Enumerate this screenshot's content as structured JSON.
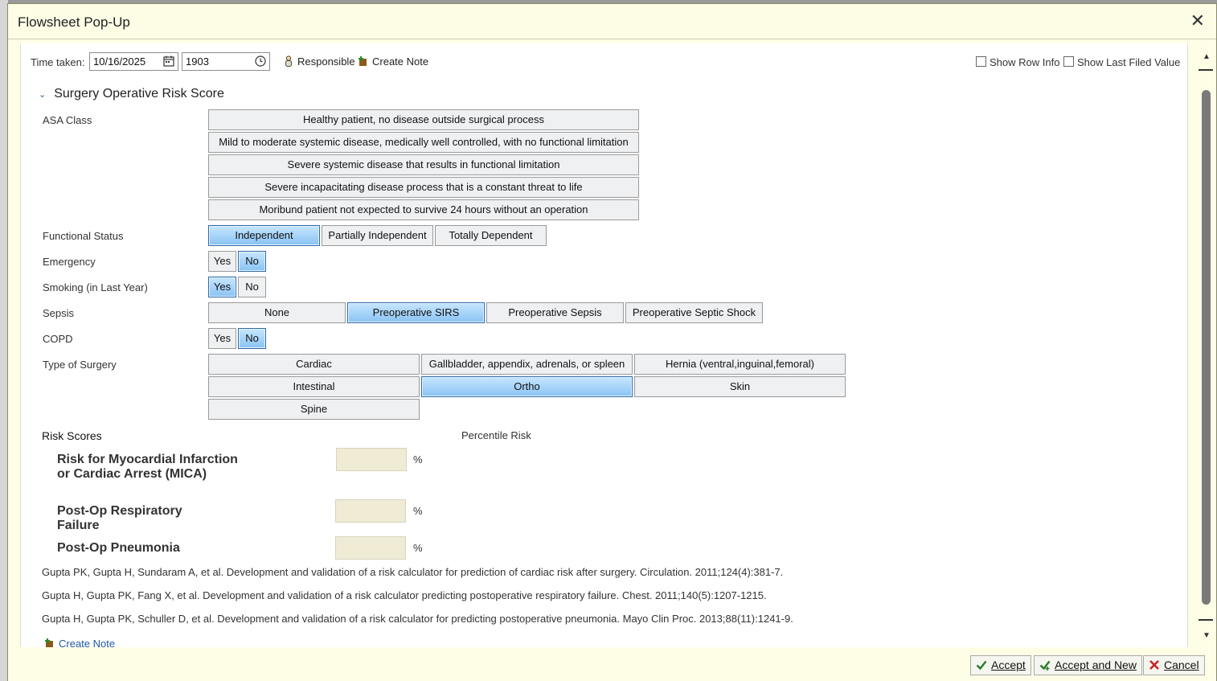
{
  "dialog": {
    "title": "Flowsheet Pop-Up",
    "close_symbol": "✕"
  },
  "toolbar": {
    "time_taken_label": "Time taken:",
    "date_value": "10/16/2025",
    "time_value": "1903",
    "responsible_label": "Responsible",
    "create_note_label": "Create Note",
    "show_row_info_label": "Show Row Info",
    "show_last_filed_label": "Show Last Filed Value"
  },
  "section": {
    "title": "Surgery Operative Risk Score"
  },
  "asa": {
    "label": "ASA Class",
    "options": [
      "Healthy patient, no disease outside surgical process",
      "Mild to moderate systemic disease, medically well controlled, with no functional limitation",
      "Severe systemic disease that results in functional limitation",
      "Severe incapacitating disease process that is a constant threat to life",
      "Moribund patient not expected to survive 24 hours without an operation"
    ]
  },
  "functional_status": {
    "label": "Functional Status",
    "options": [
      "Independent",
      "Partially Independent",
      "Totally Dependent"
    ],
    "selected": "Independent"
  },
  "emergency": {
    "label": "Emergency",
    "options": [
      "Yes",
      "No"
    ],
    "selected": "No"
  },
  "smoking": {
    "label": "Smoking (in Last Year)",
    "options": [
      "Yes",
      "No"
    ],
    "selected": "Yes"
  },
  "sepsis": {
    "label": "Sepsis",
    "options": [
      "None",
      "Preoperative SIRS",
      "Preoperative Sepsis",
      "Preoperative Septic Shock"
    ],
    "selected": "Preoperative SIRS"
  },
  "copd": {
    "label": "COPD",
    "options": [
      "Yes",
      "No"
    ],
    "selected": "No"
  },
  "surgery_type": {
    "label": "Type of Surgery",
    "options": [
      "Cardiac",
      "Gallbladder, appendix, adrenals, or spleen",
      "Hernia (ventral,inguinal,femoral)",
      "Intestinal",
      "Ortho",
      "Skin",
      "Spine"
    ],
    "selected": "Ortho"
  },
  "risk": {
    "heading": "Risk Scores",
    "percentile_heading": "Percentile Risk",
    "unit": "%",
    "items": [
      {
        "name": "Risk for Myocardial Infarction or Cardiac Arrest (MICA)",
        "value": ""
      },
      {
        "name": "Post-Op Respiratory Failure",
        "value": ""
      },
      {
        "name": "Post-Op Pneumonia",
        "value": ""
      }
    ]
  },
  "references": [
    "Gupta PK, Gupta H, Sundaram A, et al. Development and validation of a risk calculator for prediction of cardiac risk after surgery. Circulation. 2011;124(4):381-7.",
    "Gupta H, Gupta PK, Fang X, et al. Development and validation of a risk calculator predicting postoperative respiratory failure. Chest. 2011;140(5):1207-1215.",
    "Gupta H, Gupta PK, Schuller D, et al. Development and validation of a risk calculator for predicting postoperative pneumonia. Mayo Clin Proc. 2013;88(11):1241-9."
  ],
  "bottom_link": {
    "create_note_label": "Create Note"
  },
  "footer": {
    "accept_label": "Accept",
    "accept_new_label": "Accept and New",
    "cancel_label": "Cancel"
  },
  "colors": {
    "selected_fill": "#89c3f3",
    "dialog_bg": "#fefee6",
    "link": "#1f5aa6",
    "cancel_icon": "#cc2222",
    "accept_icon": "#2a7a2a"
  }
}
